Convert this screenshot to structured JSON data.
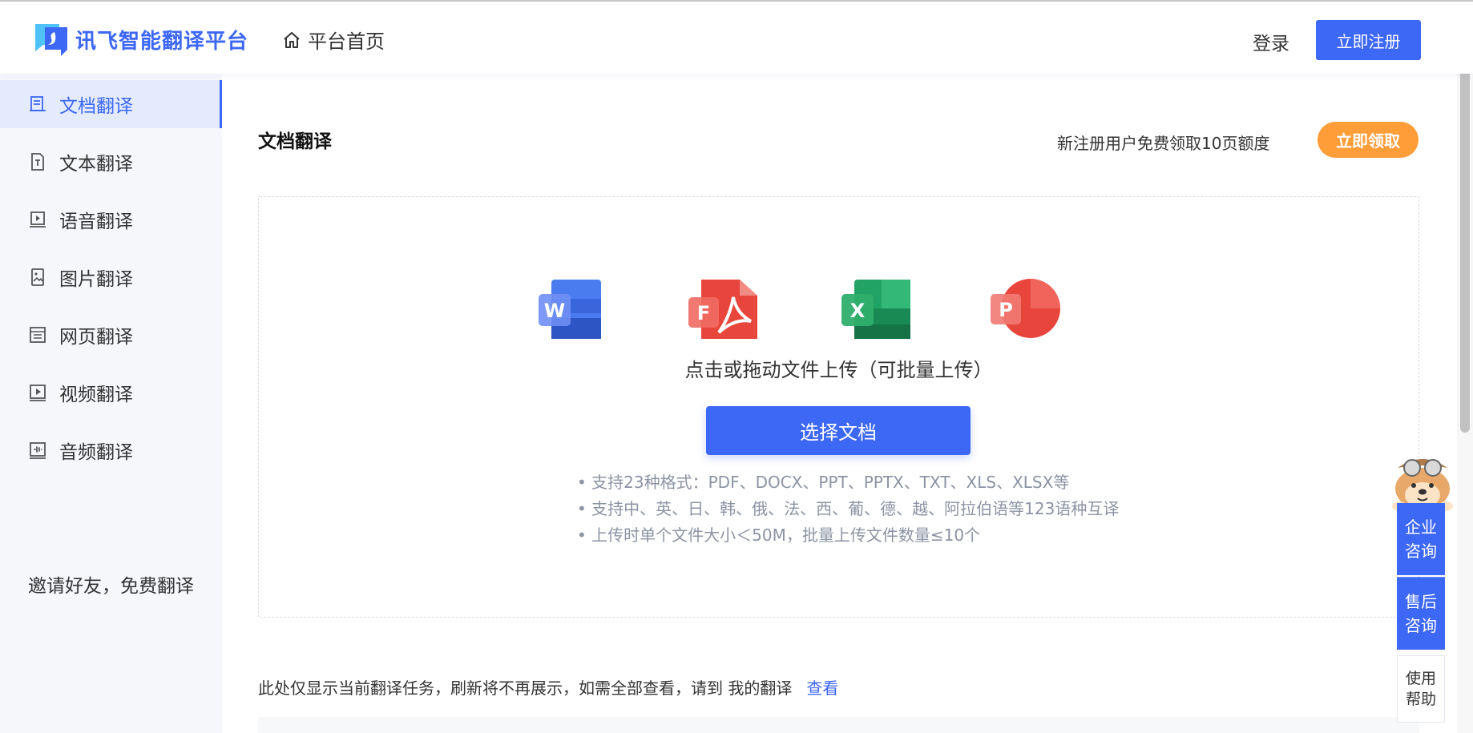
{
  "header": {
    "logo_text": "讯飞智能翻译平台",
    "home_label": "平台首页",
    "login_label": "登录",
    "register_label": "立即注册"
  },
  "sidebar": {
    "items": [
      {
        "label": "文档翻译",
        "icon": "document-icon",
        "active": true
      },
      {
        "label": "文本翻译",
        "icon": "text-icon",
        "active": false
      },
      {
        "label": "语音翻译",
        "icon": "voice-icon",
        "active": false
      },
      {
        "label": "图片翻译",
        "icon": "image-icon",
        "active": false
      },
      {
        "label": "网页翻译",
        "icon": "webpage-icon",
        "active": false
      },
      {
        "label": "视频翻译",
        "icon": "video-icon",
        "active": false
      },
      {
        "label": "音频翻译",
        "icon": "audio-icon",
        "active": false
      }
    ],
    "invite_label": "邀请好友，免费翻译"
  },
  "main": {
    "title": "文档翻译",
    "promo_text": "新注册用户免费领取10页额度",
    "promo_button": "立即领取",
    "file_types": [
      "word-icon",
      "pdf-icon",
      "excel-icon",
      "powerpoint-icon"
    ],
    "upload_hint": "点击或拖动文件上传（可批量上传）",
    "choose_button": "选择文档",
    "bullets": [
      "• 支持23种格式：PDF、DOCX、PPT、PPTX、TXT、XLS、XLSX等",
      "• 支持中、英、日、韩、俄、法、西、葡、德、越、阿拉伯语等123语种互译",
      "• 上传时单个文件大小＜50M，批量上传文件数量≤10个"
    ],
    "notice_text": "此处仅显示当前翻译任务，刷新将不再展示，如需全部查看，请到 我的翻译",
    "notice_link": "查看"
  },
  "float_panel": {
    "items": [
      "企业\n咨询",
      "售后\n咨询",
      "使用\n帮助"
    ]
  },
  "colors": {
    "primary": "#3d67f5",
    "promo": "#ff9d38",
    "sidebar_bg": "#f5f7fb",
    "sidebar_active_bg": "#e3ebfd"
  }
}
